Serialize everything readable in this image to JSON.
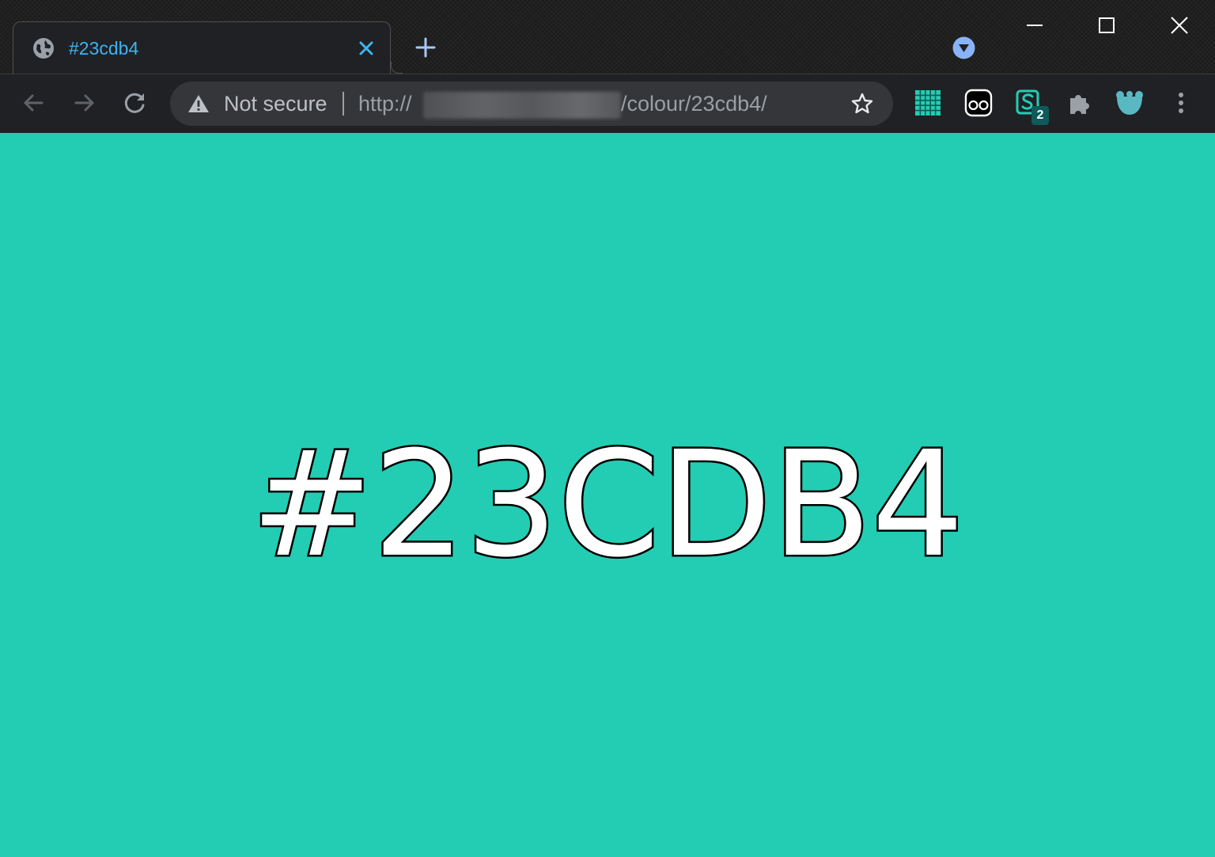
{
  "tab": {
    "title": "#23cdb4",
    "favicon_icon": "globe-icon",
    "close_icon": "close-icon"
  },
  "tabstrip": {
    "new_tab_icon": "plus-icon",
    "tab_search_icon": "tab-search-icon",
    "window_controls": [
      "minimize-icon",
      "maximize-icon",
      "close-icon"
    ]
  },
  "toolbar": {
    "back_icon": "arrow-left-icon",
    "forward_icon": "arrow-right-icon",
    "reload_icon": "reload-icon",
    "security_icon": "warning-icon",
    "security_label": "Not secure",
    "url_scheme": "http://",
    "url_path": "/colour/23cdb4/",
    "bookmark_icon": "star-icon",
    "extensions": [
      {
        "icon": "grid-icon"
      },
      {
        "icon": "eyes-icon"
      },
      {
        "icon": "s-extension-icon",
        "badge": "2"
      },
      {
        "icon": "puzzle-icon"
      },
      {
        "icon": "bear-icon"
      }
    ],
    "menu_icon": "kebab-menu-icon"
  },
  "page": {
    "heading": "#23CDB4",
    "background_color": "#23cdb4"
  },
  "colors": {
    "tab_title": "#3db4f2",
    "accent_blue": "#8ab4f8",
    "chrome_dark": "#202124",
    "omnibox": "#35363a"
  }
}
